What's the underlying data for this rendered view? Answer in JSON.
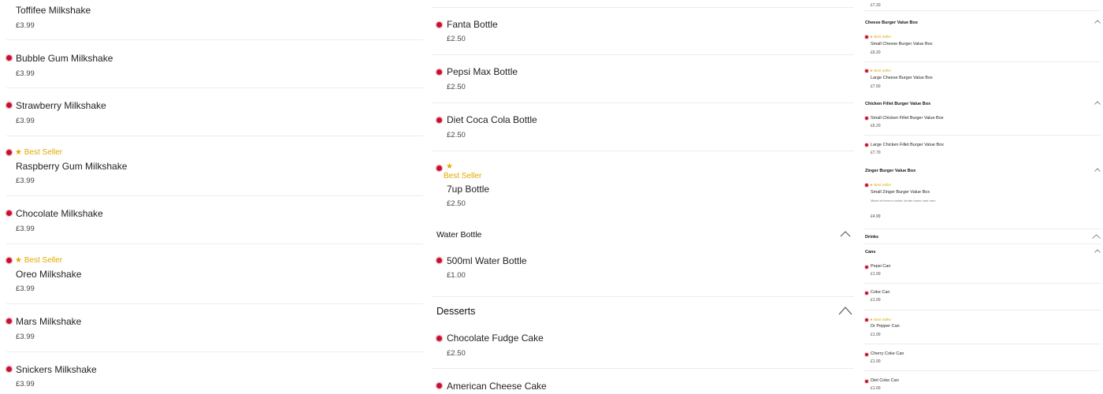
{
  "col1": {
    "items": [
      {
        "name": "Toffifee Milkshake",
        "price": "£3.99"
      },
      {
        "name": "Bubble Gum Milkshake",
        "price": "£3.99"
      },
      {
        "name": "Strawberry Milkshake",
        "price": "£3.99"
      },
      {
        "badge": "Best Seller",
        "name": "Raspberry Gum Milkshake",
        "price": "£3.99"
      },
      {
        "name": "Chocolate Milkshake",
        "price": "£3.99"
      },
      {
        "badge": "Best Seller",
        "name": "Oreo Milkshake",
        "price": "£3.99"
      },
      {
        "name": "Mars Milkshake",
        "price": "£3.99"
      },
      {
        "name": "Snickers Milkshake",
        "price": "£3.99"
      }
    ]
  },
  "col2": {
    "items": [
      {
        "name": "Fanta Bottle",
        "price": "£2.50"
      },
      {
        "name": "Pepsi Max Bottle",
        "price": "£2.50"
      },
      {
        "name": "Diet Coca Cola Bottle",
        "price": "£2.50"
      },
      {
        "badge": "Best Seller",
        "name": "7up Bottle",
        "price": "£2.50"
      }
    ],
    "water_section": {
      "title": "Water Bottle"
    },
    "water_items": [
      {
        "name": "500ml Water Bottle",
        "price": "£1.00"
      }
    ],
    "desserts_section": {
      "title": "Desserts"
    },
    "dessert_items": [
      {
        "name": "Chocolate Fudge Cake",
        "price": "£2.50"
      },
      {
        "name": "American Cheese Cake"
      }
    ]
  },
  "col3": {
    "top_price": "£7.20",
    "sections": {
      "cheese": "Cheese Burger Value Box",
      "chicken": "Chicken Fillet Burger Value Box",
      "zinger": "Zinger Burger Value Box",
      "drinks": "Drinks",
      "cans": "Cans"
    },
    "items": {
      "small_cheese": {
        "badge": "Best Seller",
        "name": "Small Cheese Burger Value Box",
        "price": "£6.20"
      },
      "large_cheese": {
        "badge": "Best Seller",
        "name": "Large Cheese Burger Value Box",
        "price": "£7.50"
      },
      "small_chicken": {
        "name": "Small Chicken Fillet Burger Value Box",
        "price": "£6.20"
      },
      "large_chicken": {
        "name": "Large Chicken Fillet Burger Value Box",
        "price": "£7.70"
      },
      "small_zinger": {
        "badge": "Best Seller",
        "name": "Small Zinger Burger Value Box",
        "description": "Mixed of ferrero rocher, kinder bueno and oreo",
        "price": "£4.99"
      },
      "pepsi_can": {
        "name": "Pepsi Can",
        "price": "£1.00"
      },
      "coke_can": {
        "name": "Coke Can",
        "price": "£1.00"
      },
      "dr_pepper_can": {
        "badge": "Best Seller",
        "name": "Dr Pepper Can",
        "price": "£1.00"
      },
      "cherry_coke_can": {
        "name": "Cherry Coke Can",
        "price": "£1.00"
      },
      "diet_coke_can": {
        "name": "Diet Coke Can",
        "price": "£1.00"
      }
    }
  },
  "icons": {
    "dot": "radio-dot-icon",
    "star": "star-icon",
    "chevron": "chevron-up-icon"
  },
  "colors": {
    "accent": "#c8102e",
    "best_seller": "#e0a800",
    "divider": "#ececec"
  }
}
